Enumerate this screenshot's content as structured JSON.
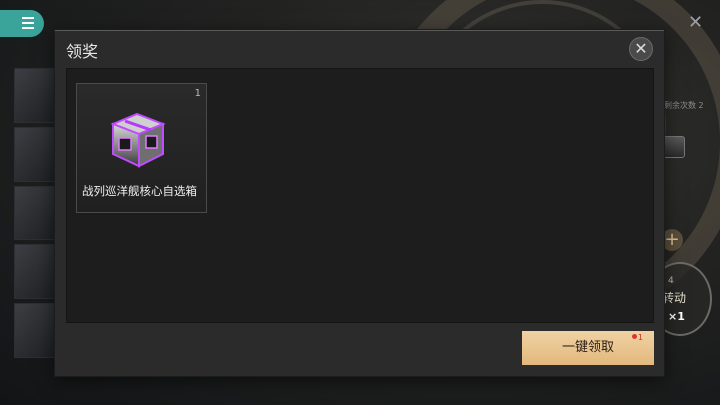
{
  "background": {
    "side_text": "剩余次数 2",
    "spin_count": "4",
    "spin_label": "转动",
    "spin_multiplier": "×1"
  },
  "modal": {
    "title": "领奖",
    "close_icon": "close-icon",
    "items": [
      {
        "name": "战列巡洋舰核心自选箱",
        "count": "1",
        "icon": "purple-chest-icon"
      }
    ],
    "claim_all_label": "一键领取",
    "claim_all_badge": "1"
  },
  "colors": {
    "menu_button": "#3aa39a",
    "claim_button": "#e8c490",
    "badge": "#d93a28",
    "chest_glow": "#c04cff"
  }
}
